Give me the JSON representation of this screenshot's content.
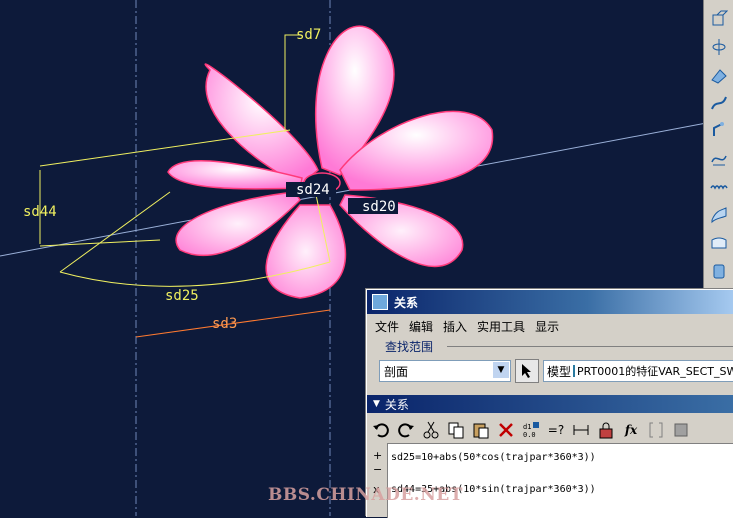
{
  "viewport": {
    "dimensions": [
      "sd7",
      "sd44",
      "sd25",
      "sd3",
      "sd20",
      "sd24"
    ],
    "colors": {
      "background": "#0d1a3a",
      "dimension": "#f0f060",
      "petal": "#ff9ee0",
      "petal_edge": "#ff3a7a",
      "centerline": "#9ab0d8"
    }
  },
  "toolbar_right": {
    "icons": [
      "datum-plane-icon",
      "datum-axis-icon",
      "datum-point-icon",
      "sketch-curve-icon",
      "datum-csys-icon",
      "curve-icon",
      "pattern-icon",
      "surface-icon",
      "fill-icon",
      "solid-icon"
    ]
  },
  "dialog": {
    "title": "关系",
    "menu": [
      "文件",
      "编辑",
      "插入",
      "实用工具",
      "显示"
    ],
    "scope_label": "查找范围",
    "scope_value": "剖面",
    "model_label": "模型",
    "model_value": "PRT0001的特征VAR_SECT_SW",
    "section_title": "关系",
    "tools": [
      "undo-icon",
      "redo-icon",
      "cut-icon",
      "copy-icon",
      "paste-icon",
      "delete-icon",
      "switch-dim-icon",
      "evaluate-icon",
      "sort-icon",
      "lock-icon",
      "function-icon",
      "bracket-icon",
      "param-icon"
    ],
    "tool_text": {
      "evaluate": "=?",
      "function": "fx"
    },
    "gutter": [
      "+",
      "−",
      "x"
    ],
    "lines": [
      "sd25=10+abs(50*cos(trajpar*360*3))",
      "sd44=35+abs(10*sin(trajpar*360*3))"
    ]
  },
  "watermark": "BBS.CHINADE.NET"
}
